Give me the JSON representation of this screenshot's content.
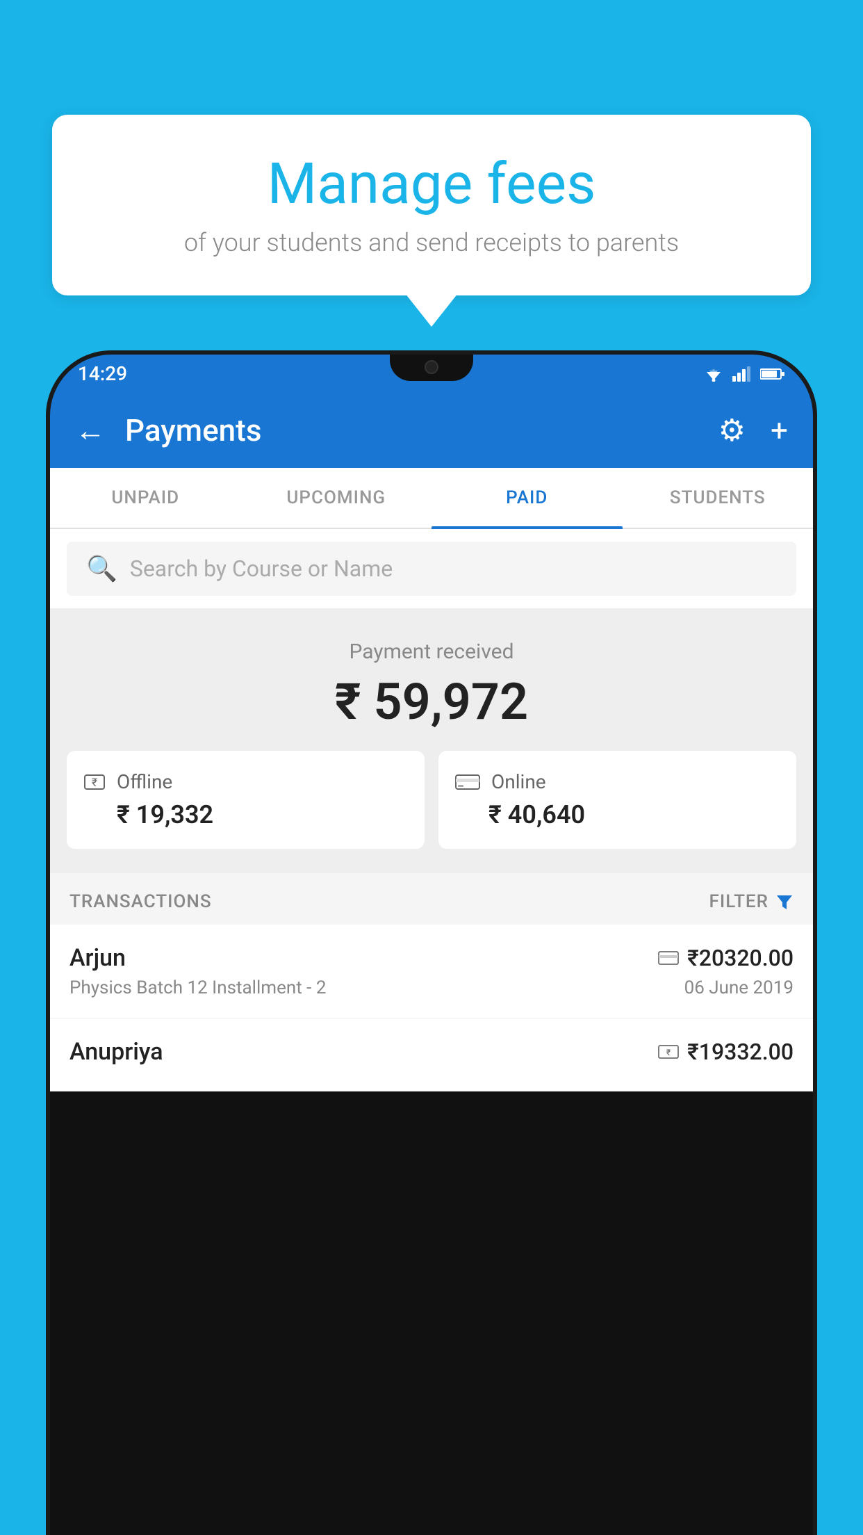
{
  "page": {
    "background_color": "#1ab4e8"
  },
  "speech_bubble": {
    "title": "Manage fees",
    "subtitle": "of your students and send receipts to parents"
  },
  "status_bar": {
    "time": "14:29",
    "wifi_icon": "▼",
    "signal_icon": "▲",
    "battery_icon": "▮"
  },
  "app_bar": {
    "back_icon": "←",
    "title": "Payments",
    "gear_icon": "⚙",
    "plus_icon": "+"
  },
  "tabs": [
    {
      "label": "UNPAID",
      "active": false
    },
    {
      "label": "UPCOMING",
      "active": false
    },
    {
      "label": "PAID",
      "active": true
    },
    {
      "label": "STUDENTS",
      "active": false
    }
  ],
  "search": {
    "placeholder": "Search by Course or Name",
    "icon": "🔍"
  },
  "payment_summary": {
    "label": "Payment received",
    "total": "₹ 59,972",
    "offline": {
      "type": "Offline",
      "amount": "₹ 19,332"
    },
    "online": {
      "type": "Online",
      "amount": "₹ 40,640"
    }
  },
  "transactions": {
    "label": "TRANSACTIONS",
    "filter_label": "FILTER",
    "items": [
      {
        "name": "Arjun",
        "course": "Physics Batch 12 Installment - 2",
        "amount": "₹20320.00",
        "date": "06 June 2019",
        "payment_type": "card"
      },
      {
        "name": "Anupriya",
        "course": "",
        "amount": "₹19332.00",
        "date": "",
        "payment_type": "cash"
      }
    ]
  }
}
